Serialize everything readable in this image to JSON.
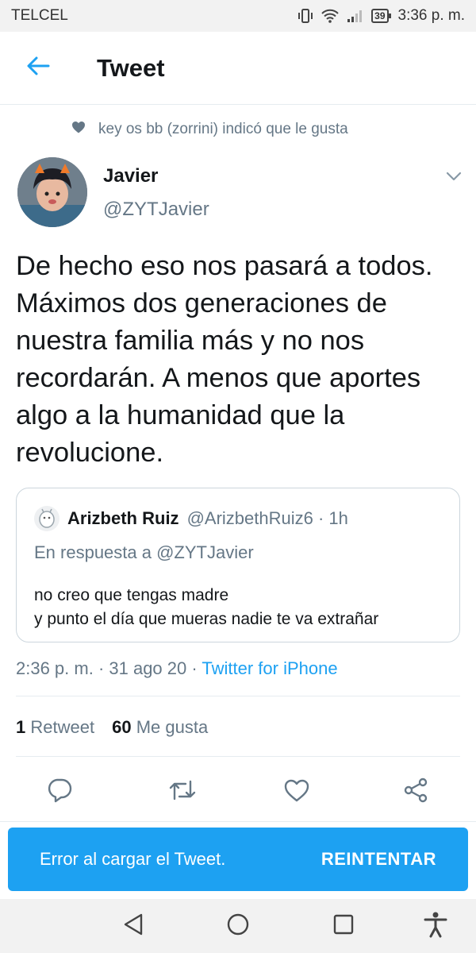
{
  "status_bar": {
    "carrier": "TELCEL",
    "battery": "39",
    "time": "3:36 p. m."
  },
  "header": {
    "title": "Tweet"
  },
  "social_context": {
    "text": "key os bb (zorrini) indicó que le gusta"
  },
  "author": {
    "name": "Javier",
    "handle": "@ZYTJavier"
  },
  "tweet": {
    "text": "De hecho eso nos pasará a todos.\nMáximos dos generaciones de\nnuestra familia más y no nos\nrecordarán. A menos que aportes\nalgo a la humanidad que la\nrevolucione."
  },
  "quoted_tweet": {
    "name": "Arizbeth Ruiz",
    "handle_time": "@ArizbethRuiz6 · 1h",
    "reply_to": "En respuesta a @ZYTJavier",
    "text": "no creo que tengas madre\ny punto el día que mueras nadie te va extrañar"
  },
  "meta": {
    "datetime": "2:36 p. m. · 31 ago 20 · ",
    "source": "Twitter for iPhone"
  },
  "stats": {
    "retweets_count": "1",
    "retweets_label": "Retweet",
    "likes_count": "60",
    "likes_label": "Me gusta"
  },
  "snackbar": {
    "message": "Error al cargar el Tweet.",
    "action": "REINTENTAR"
  },
  "colors": {
    "accent": "#1da1f2",
    "secondary_text": "#657786",
    "divider": "#e6ecf0"
  }
}
